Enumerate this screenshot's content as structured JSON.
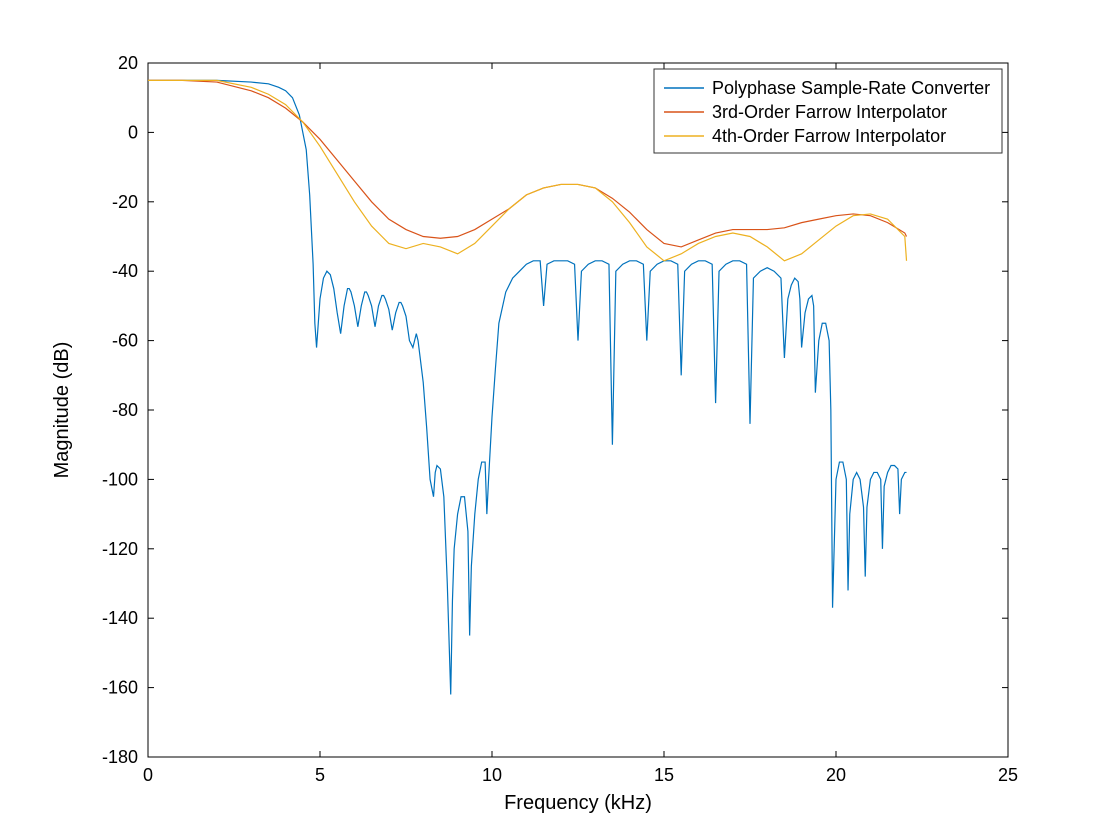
{
  "chart_data": {
    "type": "line",
    "title": "",
    "xlabel": "Frequency (kHz)",
    "ylabel": "Magnitude (dB)",
    "xlim": [
      0,
      25
    ],
    "ylim": [
      -180,
      20
    ],
    "xticks": [
      0,
      5,
      10,
      15,
      20,
      25
    ],
    "yticks": [
      -180,
      -160,
      -140,
      -120,
      -100,
      -80,
      -60,
      -40,
      -20,
      0,
      20
    ],
    "legend_position": "top-right-inside",
    "colors": {
      "polyphase": "#0072BD",
      "farrow3": "#D95319",
      "farrow4": "#EDB120",
      "axes": "#000000",
      "legend_border": "#333333"
    },
    "series": [
      {
        "name": "Polyphase Sample-Rate Converter",
        "color_key": "polyphase",
        "x": [
          0,
          1,
          2,
          3,
          3.5,
          3.8,
          4,
          4.2,
          4.4,
          4.6,
          4.7,
          4.8,
          4.85,
          4.9,
          4.95,
          5,
          5.1,
          5.2,
          5.3,
          5.4,
          5.5,
          5.6,
          5.7,
          5.8,
          5.85,
          5.9,
          6,
          6.1,
          6.2,
          6.3,
          6.35,
          6.4,
          6.5,
          6.6,
          6.7,
          6.8,
          6.85,
          6.9,
          7,
          7.1,
          7.2,
          7.3,
          7.35,
          7.4,
          7.5,
          7.6,
          7.7,
          7.8,
          7.85,
          7.9,
          8,
          8.1,
          8.2,
          8.3,
          8.35,
          8.4,
          8.5,
          8.6,
          8.7,
          8.8,
          8.85,
          8.9,
          9,
          9.1,
          9.2,
          9.3,
          9.35,
          9.4,
          9.5,
          9.6,
          9.7,
          9.8,
          9.85,
          9.9,
          10,
          10.1,
          10.2,
          10.4,
          10.6,
          10.8,
          11,
          11.2,
          11.4,
          11.5,
          11.6,
          11.8,
          12,
          12.2,
          12.4,
          12.5,
          12.6,
          12.8,
          13,
          13.2,
          13.4,
          13.5,
          13.6,
          13.8,
          14,
          14.2,
          14.4,
          14.5,
          14.6,
          14.8,
          15,
          15.2,
          15.4,
          15.5,
          15.6,
          15.8,
          16,
          16.2,
          16.4,
          16.5,
          16.6,
          16.8,
          17,
          17.2,
          17.4,
          17.5,
          17.6,
          17.8,
          18,
          18.2,
          18.4,
          18.5,
          18.6,
          18.7,
          18.8,
          18.9,
          18.95,
          19,
          19.1,
          19.2,
          19.3,
          19.35,
          19.4,
          19.5,
          19.6,
          19.7,
          19.8,
          19.85,
          19.9,
          20,
          20.1,
          20.2,
          20.3,
          20.35,
          20.4,
          20.5,
          20.6,
          20.7,
          20.8,
          20.85,
          20.9,
          21,
          21.1,
          21.2,
          21.3,
          21.35,
          21.4,
          21.5,
          21.6,
          21.7,
          21.8,
          21.85,
          21.9,
          22,
          22.05
        ],
        "y": [
          15,
          15,
          15,
          14.5,
          14,
          13,
          12,
          10,
          5,
          -5,
          -18,
          -38,
          -55,
          -62,
          -55,
          -48,
          -42,
          -40,
          -41,
          -45,
          -52,
          -58,
          -50,
          -45,
          -45,
          -46,
          -50,
          -56,
          -50,
          -46,
          -46,
          -47,
          -50,
          -56,
          -50,
          -47,
          -47,
          -48,
          -51,
          -57,
          -52,
          -49,
          -49,
          -50,
          -53,
          -60,
          -62,
          -58,
          -60,
          -64,
          -72,
          -85,
          -100,
          -105,
          -98,
          -96,
          -97,
          -105,
          -130,
          -162,
          -135,
          -120,
          -110,
          -105,
          -105,
          -115,
          -145,
          -125,
          -110,
          -100,
          -95,
          -95,
          -110,
          -100,
          -82,
          -68,
          -55,
          -46,
          -42,
          -40,
          -38,
          -37,
          -37,
          -50,
          -38,
          -37,
          -37,
          -37,
          -38,
          -60,
          -40,
          -38,
          -37,
          -37,
          -38,
          -90,
          -40,
          -38,
          -37,
          -37,
          -38,
          -60,
          -40,
          -38,
          -37,
          -37,
          -38,
          -70,
          -40,
          -38,
          -37,
          -37,
          -38,
          -78,
          -40,
          -38,
          -37,
          -37,
          -38,
          -84,
          -42,
          -40,
          -39,
          -40,
          -42,
          -65,
          -48,
          -44,
          -42,
          -43,
          -48,
          -62,
          -52,
          -48,
          -47,
          -50,
          -75,
          -60,
          -55,
          -55,
          -60,
          -80,
          -137,
          -100,
          -95,
          -95,
          -100,
          -132,
          -110,
          -100,
          -98,
          -100,
          -108,
          -128,
          -108,
          -100,
          -98,
          -98,
          -100,
          -120,
          -102,
          -98,
          -96,
          -96,
          -97,
          -110,
          -100,
          -98,
          -98
        ]
      },
      {
        "name": "3rd-Order Farrow Interpolator",
        "color_key": "farrow3",
        "x": [
          0,
          1,
          2,
          3,
          3.5,
          4,
          4.5,
          5,
          5.5,
          6,
          6.5,
          7,
          7.5,
          8,
          8.5,
          9,
          9.5,
          10,
          10.5,
          11,
          11.5,
          12,
          12.5,
          13,
          13.5,
          14,
          14.5,
          15,
          15.5,
          16,
          16.5,
          17,
          17.5,
          18,
          18.5,
          19,
          19.5,
          20,
          20.5,
          21,
          21.5,
          22,
          22.05
        ],
        "y": [
          15,
          15,
          14.5,
          12,
          10,
          7,
          3,
          -2,
          -8,
          -14,
          -20,
          -25,
          -28,
          -30,
          -30.5,
          -30,
          -28,
          -25,
          -22,
          -18,
          -16,
          -15,
          -15,
          -16,
          -19,
          -23,
          -28,
          -32,
          -33,
          -31,
          -29,
          -28,
          -28,
          -28,
          -27.5,
          -26,
          -25,
          -24,
          -23.5,
          -24,
          -26,
          -29,
          -30
        ]
      },
      {
        "name": "4th-Order Farrow Interpolator",
        "color_key": "farrow4",
        "x": [
          0,
          1,
          2,
          3,
          3.5,
          4,
          4.5,
          5,
          5.5,
          6,
          6.5,
          7,
          7.5,
          8,
          8.5,
          9,
          9.5,
          10,
          10.5,
          11,
          11.5,
          12,
          12.5,
          13,
          13.5,
          14,
          14.5,
          15,
          15.5,
          16,
          16.5,
          17,
          17.5,
          18,
          18.5,
          19,
          19.5,
          20,
          20.5,
          21,
          21.5,
          22,
          22.05
        ],
        "y": [
          15,
          15,
          15,
          13,
          11,
          8,
          3,
          -4,
          -12,
          -20,
          -27,
          -32,
          -33.5,
          -32,
          -33,
          -35,
          -32,
          -27,
          -22,
          -18,
          -16,
          -15,
          -15,
          -16,
          -20,
          -26,
          -33,
          -37,
          -35,
          -32,
          -30,
          -29,
          -30,
          -33,
          -37,
          -35,
          -31,
          -27,
          -24,
          -23.5,
          -25,
          -30,
          -37
        ]
      }
    ]
  }
}
